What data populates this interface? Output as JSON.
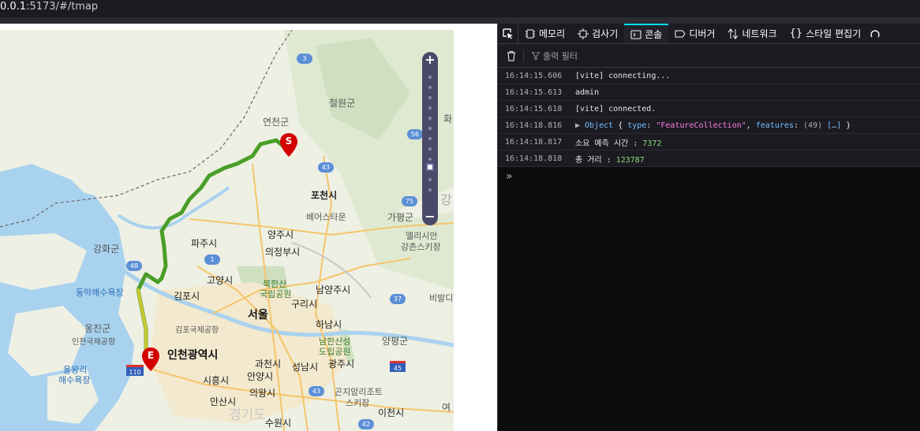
{
  "browser": {
    "url_host": "0.0.1",
    "url_rest": ":5173/#/tmap"
  },
  "devtools": {
    "tabs": [
      {
        "label": "메모리",
        "icon": "memory-icon"
      },
      {
        "label": "검사기",
        "icon": "inspector-icon"
      },
      {
        "label": "콘솔",
        "icon": "console-icon",
        "active": true
      },
      {
        "label": "디버거",
        "icon": "debugger-icon"
      },
      {
        "label": "네트워크",
        "icon": "network-icon"
      },
      {
        "label": "스타일 편집기",
        "icon": "style-editor-icon"
      }
    ],
    "filter_placeholder": "출력 필터",
    "logs": [
      {
        "time": "16:14:15.606",
        "text": "[vite] connecting..."
      },
      {
        "time": "16:14:15.613",
        "text": "admin"
      },
      {
        "time": "16:14:15.618",
        "text": "[vite] connected."
      },
      {
        "time": "16:14:18.816",
        "obj_label": "Object",
        "type_key": "type",
        "type_val": "\"FeatureCollection\"",
        "features_key": "features",
        "features_val": "(49)",
        "features_arr": "[…]"
      },
      {
        "time": "16:14:18.817",
        "text": "소요 예측 시간 : ",
        "value": "7372"
      },
      {
        "time": "16:14:18.818",
        "text": "총 거리 : ",
        "value": "123787"
      }
    ],
    "prompt": "»"
  },
  "map": {
    "labels": {
      "yeoncheon": "연천군",
      "cheorwon": "철원군",
      "pocheon": "포천시",
      "besuta": "베어스타운",
      "gapyeong": "가평군",
      "elysian": "엘리시안",
      "gangchon": "강촌스키장",
      "yangju": "양주시",
      "uijeongbu": "의정부시",
      "paju": "파주시",
      "ganghwa": "강화군",
      "goyang": "고양시",
      "bukhansan": "북한산",
      "bukhansan2": "국립공원",
      "namyangju": "남양주시",
      "gimpo": "김포시",
      "guri": "구리시",
      "seoul": "서울",
      "gimpo_airport": "김포국제공항",
      "hanam": "하남시",
      "dongmak": "동막해수욕장",
      "ongjin": "옹진군",
      "incheon_airport": "인천국제공항",
      "incheon": "인천광역시",
      "namhansan": "남한산성",
      "namhansan2": "도립공원",
      "yangpyeong": "양평군",
      "eurwang": "을왕리",
      "eurwang2": "해수욕장",
      "gwacheon": "과천시",
      "seongnam": "성남시",
      "gwangju": "광주시",
      "anyang": "안양시",
      "siheung": "시흥시",
      "gonjiam": "곤지암리조트",
      "gonjiam2": "스키장",
      "uiwang": "의왕시",
      "ansan": "안산시",
      "icheon": "이천시",
      "suwon": "수원시",
      "gyeonggi": "경기도",
      "bibal": "비발디",
      "ga": "가",
      "hwa": "화",
      "gang": "강",
      "yeo": "여",
      "start": "S",
      "end": "E"
    },
    "road_numbers": [
      "3",
      "56",
      "43",
      "75",
      "1",
      "48",
      "37",
      "45",
      "110",
      "43",
      "42"
    ],
    "route_color": "#4a9e28",
    "route_alt_color": "#c9c832"
  }
}
